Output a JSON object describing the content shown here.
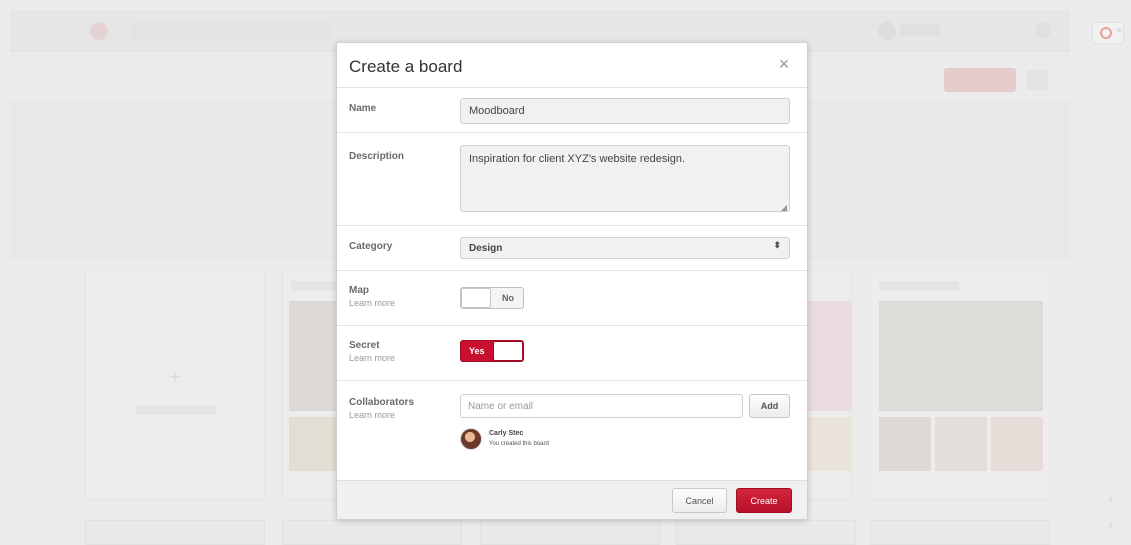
{
  "modal": {
    "title": "Create a board",
    "close_icon": "close-icon",
    "name": {
      "label": "Name",
      "value": "Moodboard"
    },
    "description": {
      "label": "Description",
      "value": "Inspiration for client XYZ's website redesign."
    },
    "category": {
      "label": "Category",
      "selected": "Design",
      "arrows": "⬍"
    },
    "map": {
      "label": "Map",
      "sublabel": "Learn more",
      "toggle_label": "No",
      "state": "off"
    },
    "secret": {
      "label": "Secret",
      "sublabel": "Learn more",
      "toggle_label": "Yes",
      "state": "on"
    },
    "collaborators": {
      "label": "Collaborators",
      "sublabel": "Learn more",
      "placeholder": "Name or email",
      "add_label": "Add",
      "members": [
        {
          "name": "Carly Stec",
          "note": "You created this board"
        }
      ]
    },
    "footer": {
      "cancel_label": "Cancel",
      "create_label": "Create"
    }
  },
  "colors": {
    "accent": "#c8102e",
    "overlay": "#e9e9e9"
  }
}
